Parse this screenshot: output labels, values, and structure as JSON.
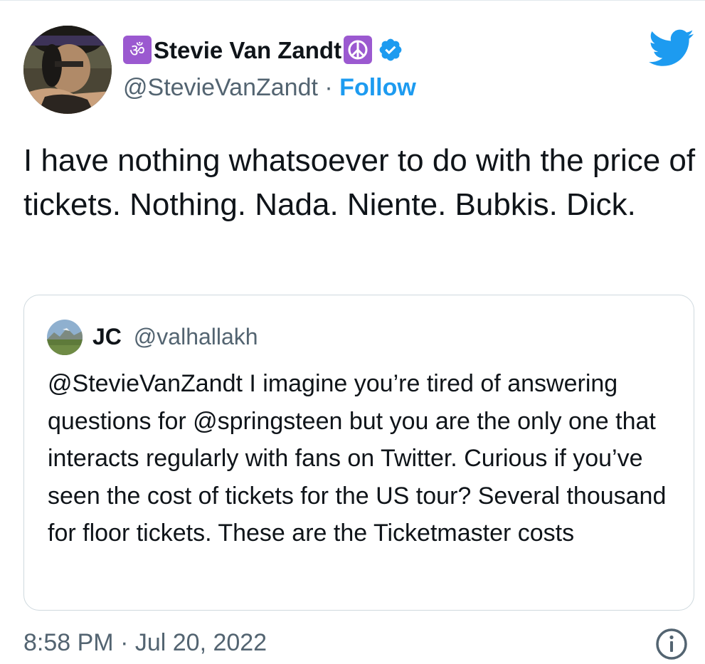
{
  "author": {
    "display_name": "Stevie Van Zandt",
    "name_prefix_emoji": "om-symbol-icon",
    "name_suffix_emoji": "peace-symbol-icon",
    "handle": "@StevieVanZandt",
    "separator": "·",
    "follow_label": "Follow",
    "verified": true
  },
  "tweet": {
    "text": "I have nothing whatsoever to do with the price of tickets. Nothing. Nada. Niente. Bubkis. Dick."
  },
  "quoted_tweet": {
    "name": "JC",
    "handle": "@valhallakh",
    "text": "@StevieVanZandt I imagine you’re tired of answering questions for @springsteen but you are the only one that interacts regularly with fans on Twitter. Curious if you’ve seen the cost of tickets for the US tour? Several thousand for floor tickets. These are the Ticketmaster costs"
  },
  "footer": {
    "timestamp": "8:58 PM · Jul 20, 2022"
  },
  "colors": {
    "accent": "#1d9bf0",
    "secondary_text": "#536471",
    "badge_purple": "#9b59d0"
  }
}
